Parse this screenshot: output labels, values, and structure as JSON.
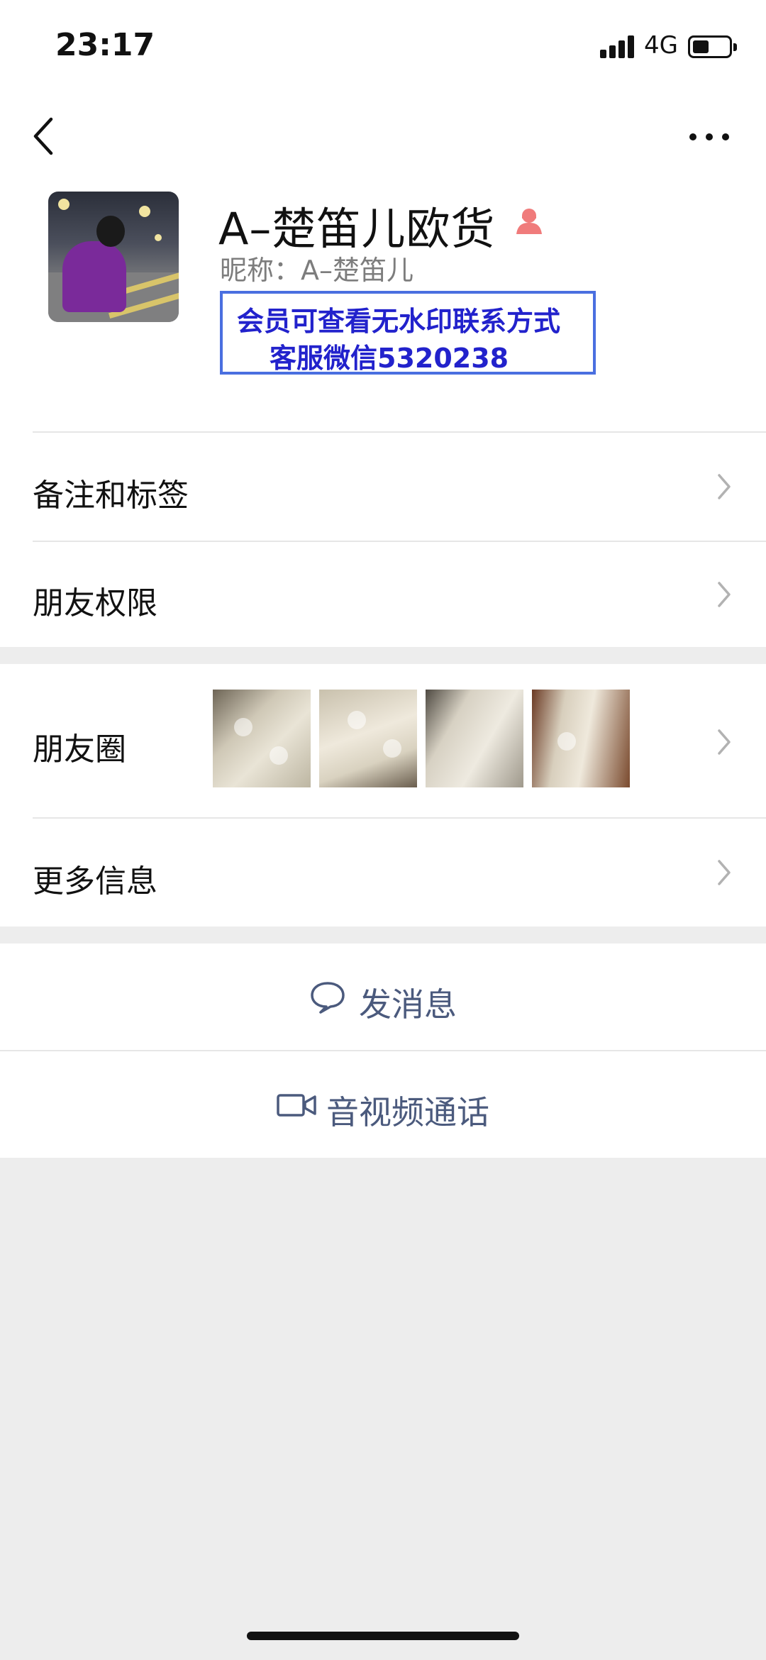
{
  "status_bar": {
    "time": "23:17",
    "network": "4G"
  },
  "profile": {
    "name": "A–楚笛儿欧货",
    "nickname": "昵称：A–楚笛儿",
    "watermark_line1": "会员可查看无水印联系方式",
    "watermark_line2": "客服微信5320238"
  },
  "list": {
    "remarks_tags": "备注和标签",
    "friend_permissions": "朋友权限",
    "moments": "朋友圈",
    "more_info": "更多信息"
  },
  "actions": {
    "send_message": "发消息",
    "av_call": "音视频通话"
  },
  "colors": {
    "link": "#4b5a7d",
    "watermark_text": "#2222cc",
    "watermark_border": "#4a6fe0",
    "female_icon": "#f07b7b",
    "background": "#ededed"
  }
}
